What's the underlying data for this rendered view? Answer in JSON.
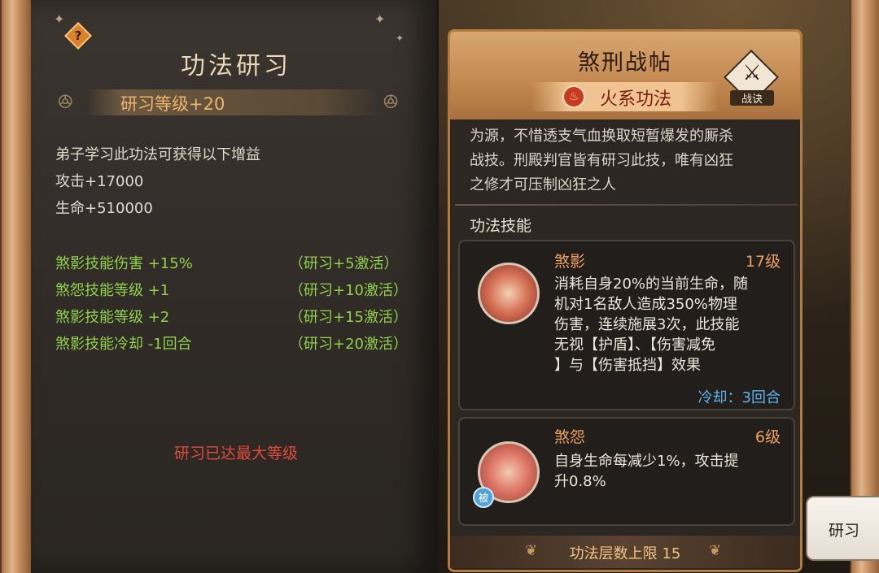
{
  "left_panel": {
    "title": "功法研习",
    "level_bonus": "研习等级+20",
    "intro": "弟子学习此功法可获得以下增益",
    "stats": [
      "攻击+17000",
      "生命+510000"
    ],
    "bonuses": [
      {
        "effect": "煞影技能伤害 +15%",
        "condition": "（研习+5激活）"
      },
      {
        "effect": "煞怨技能等级 +1",
        "condition": "（研习+10激活）"
      },
      {
        "effect": "煞影技能等级 +2",
        "condition": "（研习+15激活）"
      },
      {
        "effect": "煞影技能冷却 -1回合",
        "condition": "（研习+20激活）"
      }
    ],
    "max_level_text": "研习已达最大等级"
  },
  "card": {
    "title": "煞刑战帖",
    "element": "火系功法",
    "badge_label": "战诀",
    "description": [
      "为源，不惜透支气血换取短暂爆发的厮杀",
      "战技。刑殿判官皆有研习此技，唯有凶狂",
      "之修才可压制凶狂之人"
    ],
    "section_title": "功法技能",
    "skills": [
      {
        "name": "煞影",
        "level": "17级",
        "desc": [
          "消耗自身20%的当前生命，随",
          "机对1名敌人造成350%物理",
          "伤害，连续施展3次，此技能",
          "无视【护盾】、【伤害减免",
          "】与【伤害抵挡】效果"
        ],
        "cooldown": "冷却：3回合"
      },
      {
        "name": "煞怨",
        "level": "6级",
        "desc": [
          "自身生命每减少1%，攻击提",
          "升0.8%"
        ],
        "passive_badge": "被"
      }
    ],
    "footer": "功法层数上限 15"
  },
  "study_button": "研习",
  "colors": {
    "accent_orange": "#f0a060",
    "bonus_green": "#8fd14a",
    "alert_red": "#e04a3a",
    "cooldown_blue": "#5cb3ee"
  }
}
